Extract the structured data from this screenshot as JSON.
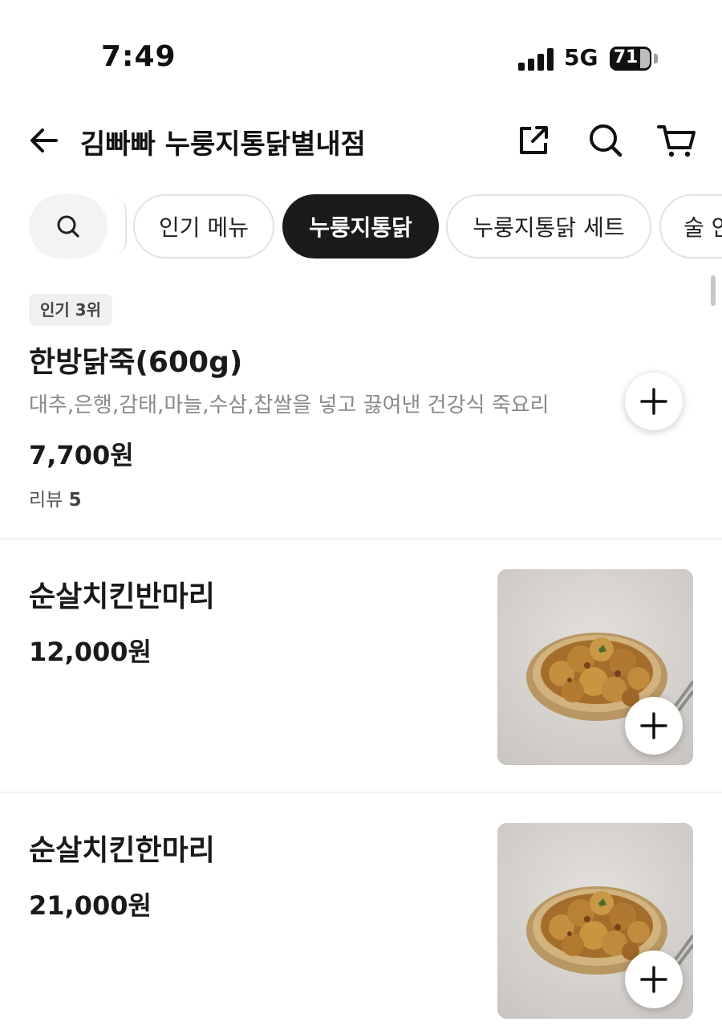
{
  "status_bar": {
    "time": "7:49",
    "network": "5G",
    "battery": "71"
  },
  "header": {
    "store_name": "김빠빠 누룽지통닭별내점"
  },
  "categories": [
    {
      "label": "인기 메뉴",
      "active": false
    },
    {
      "label": "누룽지통닭",
      "active": true
    },
    {
      "label": "누룽지통닭 세트",
      "active": false
    },
    {
      "label": "술 안",
      "active": false
    }
  ],
  "menu_items": [
    {
      "badge": "인기 3위",
      "name": "한방닭죽(600g)",
      "description": "대추,은행,감태,마늘,수삼,찹쌀을 넣고 끓여낸 건강식 죽요리",
      "price": "7,700원",
      "review_label": "리뷰",
      "review_count": "5"
    },
    {
      "name": "순살치킨반마리",
      "price": "12,000원",
      "image": "boneless-chicken-plate"
    },
    {
      "name": "순살치킨한마리",
      "price": "21,000원",
      "image": "boneless-chicken-plate"
    }
  ],
  "icons": {
    "back": "arrow-left-icon",
    "share": "share-icon",
    "search": "search-icon",
    "cart": "cart-icon",
    "add": "plus-icon"
  }
}
